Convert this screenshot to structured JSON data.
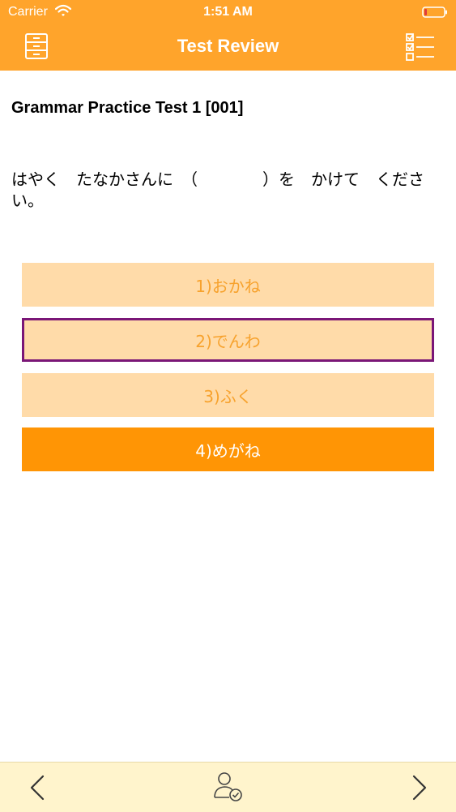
{
  "status_bar": {
    "carrier": "Carrier",
    "time": "1:51 AM"
  },
  "nav": {
    "title": "Test Review",
    "left_icon": "file-cabinet-icon",
    "right_icon": "checklist-icon"
  },
  "test": {
    "title": "Grammar Practice Test 1 [001]",
    "question": "はやく　たなかさんに　（　　　　）を　かけて　ください。"
  },
  "options": [
    {
      "label": "1)おかね",
      "state": "normal"
    },
    {
      "label": "2)でんわ",
      "state": "selected"
    },
    {
      "label": "3)ふく",
      "state": "normal"
    },
    {
      "label": "4)めがね",
      "state": "highlighted"
    }
  ],
  "footer": {
    "prev_icon": "chevron-left-icon",
    "center_icon": "user-check-icon",
    "next_icon": "chevron-right-icon"
  },
  "colors": {
    "header": "#FFA42B",
    "option_bg": "#FFDBA9",
    "option_text": "#F7A22D",
    "highlight_bg": "#FF9505",
    "selected_border": "#7A1677",
    "footer_bg": "#FFF4CC"
  }
}
